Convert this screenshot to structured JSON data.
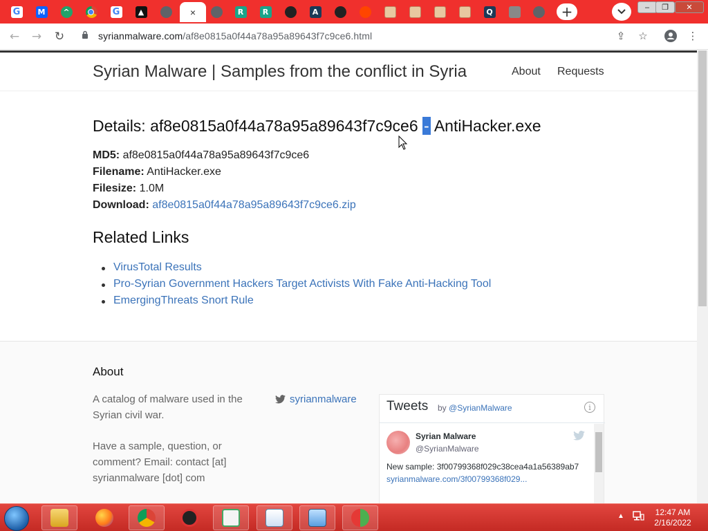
{
  "browser": {
    "tabs": [
      {
        "icon": "google-icon",
        "glyph": "G"
      },
      {
        "icon": "malwarebytes-icon",
        "glyph": "M"
      },
      {
        "icon": "green-app-icon",
        "glyph": "^"
      },
      {
        "icon": "chrome-icon",
        "glyph": ""
      },
      {
        "icon": "google-icon",
        "glyph": "G"
      },
      {
        "icon": "vercel-icon",
        "glyph": "▲"
      },
      {
        "icon": "globe-icon",
        "glyph": ""
      },
      {
        "icon": "active-tab-icon",
        "glyph": "×"
      },
      {
        "icon": "globe-icon",
        "glyph": ""
      },
      {
        "icon": "replit-icon",
        "glyph": "R"
      },
      {
        "icon": "replit-icon",
        "glyph": "R"
      },
      {
        "icon": "github-icon",
        "glyph": ""
      },
      {
        "icon": "arch-icon",
        "glyph": "A"
      },
      {
        "icon": "github-icon",
        "glyph": ""
      },
      {
        "icon": "reddit-icon",
        "glyph": ""
      },
      {
        "icon": "image-thumb-icon",
        "glyph": ""
      },
      {
        "icon": "image-thumb-icon",
        "glyph": ""
      },
      {
        "icon": "image-thumb-icon",
        "glyph": ""
      },
      {
        "icon": "image-thumb-icon",
        "glyph": ""
      },
      {
        "icon": "q-app-icon",
        "glyph": "Q"
      },
      {
        "icon": "dots-app-icon",
        "glyph": ""
      },
      {
        "icon": "globe-icon",
        "glyph": ""
      }
    ],
    "url_host": "syrianmalware.com",
    "url_path": "/af8e0815a0f44a78a95a89643f7c9ce6.html"
  },
  "site": {
    "title": "Syrian Malware | Samples from the conflict in Syria",
    "nav": {
      "about": "About",
      "requests": "Requests"
    }
  },
  "details": {
    "heading_prefix": "Details: af8e0815a0f44a78a95a89643f7c9ce6",
    "heading_sep": "-",
    "heading_suffix": "AntiHacker.exe",
    "md5_label": "MD5:",
    "md5": "af8e0815a0f44a78a95a89643f7c9ce6",
    "filename_label": "Filename:",
    "filename": "AntiHacker.exe",
    "filesize_label": "Filesize:",
    "filesize": "1.0M",
    "download_label": "Download:",
    "download": "af8e0815a0f44a78a95a89643f7c9ce6.zip"
  },
  "related": {
    "heading": "Related Links",
    "links": [
      "VirusTotal Results",
      "Pro-Syrian Government Hackers Target Activists With Fake Anti-Hacking Tool",
      "EmergingThreats Snort Rule"
    ]
  },
  "footer": {
    "about_heading": "About",
    "about_p1": "A catalog of malware used in the Syrian civil war.",
    "about_p2": "Have a sample, question, or comment? Email: contact [at] syrianmalware [dot] com",
    "twitter_handle": "syrianmalware",
    "tweets": {
      "heading": "Tweets",
      "by": "by",
      "by_handle": "@SyrianMalware",
      "info": "i",
      "author_name": "Syrian Malware",
      "author_handle": "@SyrianMalware",
      "text": "New sample: 3f00799368f029c38cea4a1a56389ab7",
      "link": "syrianmalware.com/3f00799368f029..."
    }
  },
  "taskbar": {
    "time": "12:47 AM",
    "date": "2/16/2022",
    "apps": [
      "firefox-icon",
      "chrome-icon",
      "red-app-icon",
      "notepad-icon",
      "wordpad-icon",
      "control-panel-icon",
      "network-app-icon"
    ]
  },
  "colors": {
    "accent": "#f0302d",
    "link": "#3b73b9",
    "taskbar": "#c42a24"
  }
}
